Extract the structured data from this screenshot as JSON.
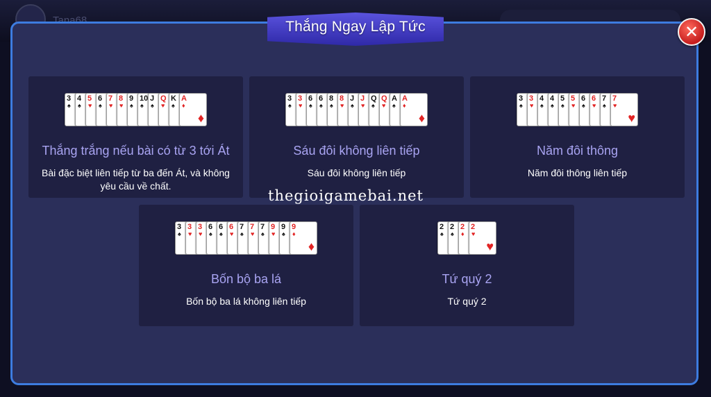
{
  "header": {
    "player_name": "Tana68"
  },
  "dialog": {
    "title": "Thắng Ngay Lập Tức",
    "close_label": "✕"
  },
  "watermark": "thegioigamebai.net",
  "colors": {
    "panel_border": "#3d7ce0",
    "panel_bg": "#2b2f5a",
    "box_bg": "#1f2042",
    "box_title": "#a9a4f2",
    "banner": "#4a44cc",
    "close": "#d42a22",
    "red_suit": "#e22424"
  },
  "rules": [
    {
      "title": "Thắng trắng nếu bài có từ 3 tới Át",
      "description": "Bài đặc biệt liên tiếp từ ba đến Át, và không yêu cầu về chất.",
      "cards": [
        {
          "rank": "3",
          "suit": "♠"
        },
        {
          "rank": "4",
          "suit": "♠"
        },
        {
          "rank": "5",
          "suit": "♥"
        },
        {
          "rank": "6",
          "suit": "♠"
        },
        {
          "rank": "7",
          "suit": "♥"
        },
        {
          "rank": "8",
          "suit": "♥"
        },
        {
          "rank": "9",
          "suit": "♠"
        },
        {
          "rank": "10",
          "suit": "♠"
        },
        {
          "rank": "J",
          "suit": "♠"
        },
        {
          "rank": "Q",
          "suit": "♥"
        },
        {
          "rank": "K",
          "suit": "♠"
        },
        {
          "rank": "A",
          "suit": "♦"
        }
      ]
    },
    {
      "title": "Sáu đôi không liên tiếp",
      "description": "Sáu đôi không liên tiếp",
      "cards": [
        {
          "rank": "3",
          "suit": "♠"
        },
        {
          "rank": "3",
          "suit": "♥"
        },
        {
          "rank": "6",
          "suit": "♠"
        },
        {
          "rank": "6",
          "suit": "♠"
        },
        {
          "rank": "8",
          "suit": "♠"
        },
        {
          "rank": "8",
          "suit": "♥"
        },
        {
          "rank": "J",
          "suit": "♠"
        },
        {
          "rank": "J",
          "suit": "♥"
        },
        {
          "rank": "Q",
          "suit": "♠"
        },
        {
          "rank": "Q",
          "suit": "♥"
        },
        {
          "rank": "A",
          "suit": "♠"
        },
        {
          "rank": "A",
          "suit": "♦"
        }
      ]
    },
    {
      "title": "Năm đôi thông",
      "description": "Năm đôi thông liên tiếp",
      "cards": [
        {
          "rank": "3",
          "suit": "♠"
        },
        {
          "rank": "3",
          "suit": "♥"
        },
        {
          "rank": "4",
          "suit": "♠"
        },
        {
          "rank": "4",
          "suit": "♠"
        },
        {
          "rank": "5",
          "suit": "♠"
        },
        {
          "rank": "5",
          "suit": "♥"
        },
        {
          "rank": "6",
          "suit": "♠"
        },
        {
          "rank": "6",
          "suit": "♥"
        },
        {
          "rank": "7",
          "suit": "♠"
        },
        {
          "rank": "7",
          "suit": "♥"
        }
      ]
    },
    {
      "title": "Bốn bộ ba lá",
      "description": "Bốn bộ ba lá không liên tiếp",
      "cards": [
        {
          "rank": "3",
          "suit": "♠"
        },
        {
          "rank": "3",
          "suit": "♥"
        },
        {
          "rank": "3",
          "suit": "♥"
        },
        {
          "rank": "6",
          "suit": "♠"
        },
        {
          "rank": "6",
          "suit": "♠"
        },
        {
          "rank": "6",
          "suit": "♥"
        },
        {
          "rank": "7",
          "suit": "♠"
        },
        {
          "rank": "7",
          "suit": "♥"
        },
        {
          "rank": "7",
          "suit": "♠"
        },
        {
          "rank": "9",
          "suit": "♥"
        },
        {
          "rank": "9",
          "suit": "♠"
        },
        {
          "rank": "9",
          "suit": "♦"
        }
      ]
    },
    {
      "title": "Tứ quý 2",
      "description": "Tứ quý 2",
      "cards": [
        {
          "rank": "2",
          "suit": "♠"
        },
        {
          "rank": "2",
          "suit": "♠"
        },
        {
          "rank": "2",
          "suit": "♦"
        },
        {
          "rank": "2",
          "suit": "♥"
        }
      ]
    }
  ]
}
